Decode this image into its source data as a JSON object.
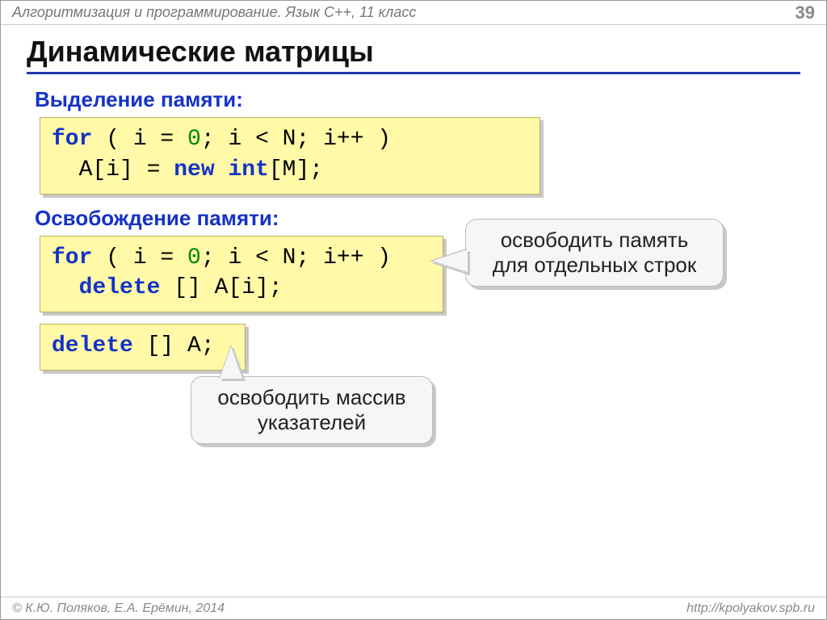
{
  "header": {
    "course": "Алгоритмизация и программирование. Язык C++, 11 класс",
    "page": "39"
  },
  "title": "Динамические матрицы",
  "sections": {
    "alloc_label": "Выделение памяти:",
    "free_label": "Освобождение памяти:"
  },
  "code": {
    "alloc": {
      "l1_kw": "for",
      "l1_rest_a": " ( i = ",
      "l1_zero": "0",
      "l1_rest_b": "; i < N; i++ )",
      "l2_indent": "  A[i] = ",
      "l2_kw": "new int",
      "l2_rest": "[M];"
    },
    "free_loop": {
      "l1_kw": "for",
      "l1_rest_a": " ( i = ",
      "l1_zero": "0",
      "l1_rest_b": "; i < N; i++ )",
      "l2_indent": "  ",
      "l2_kw": "delete",
      "l2_rest": " [] A[i];"
    },
    "free_arr": {
      "kw": "delete",
      "rest": " [] A;"
    }
  },
  "callouts": {
    "rows": "освободить память для отдельных строк",
    "ptrs": "освободить массив указателей"
  },
  "footer": {
    "authors": "© К.Ю. Поляков, Е.А. Ерёмин, 2014",
    "url": "http://kpolyakov.spb.ru"
  }
}
